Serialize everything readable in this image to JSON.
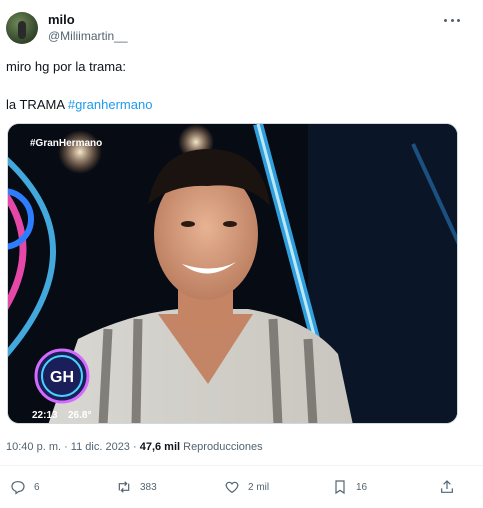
{
  "author": {
    "display_name": "milo",
    "handle": "@Miliimartin__"
  },
  "tweet": {
    "line1": "miro hg por la trama:",
    "line2_text": "la TRAMA ",
    "line2_hashtag": "#granhermano"
  },
  "media": {
    "overlay_tag": "#GranHermano",
    "logo_text": "GH",
    "clock": "22:13",
    "temperature": "26.8°"
  },
  "meta": {
    "timestamp": "10:40 p. m. · 11 dic. 2023 · ",
    "views_count": "47,6 mil",
    "views_label": " Reproducciones"
  },
  "actions": {
    "replies": "6",
    "reposts": "383",
    "likes": "2 mil",
    "bookmarks": "16"
  },
  "icons": [
    "more-icon",
    "reply-icon",
    "repost-icon",
    "like-icon",
    "bookmark-icon",
    "share-icon"
  ],
  "colors": {
    "link": "#1d9bf0",
    "muted": "#536471",
    "text": "#0f1419"
  }
}
